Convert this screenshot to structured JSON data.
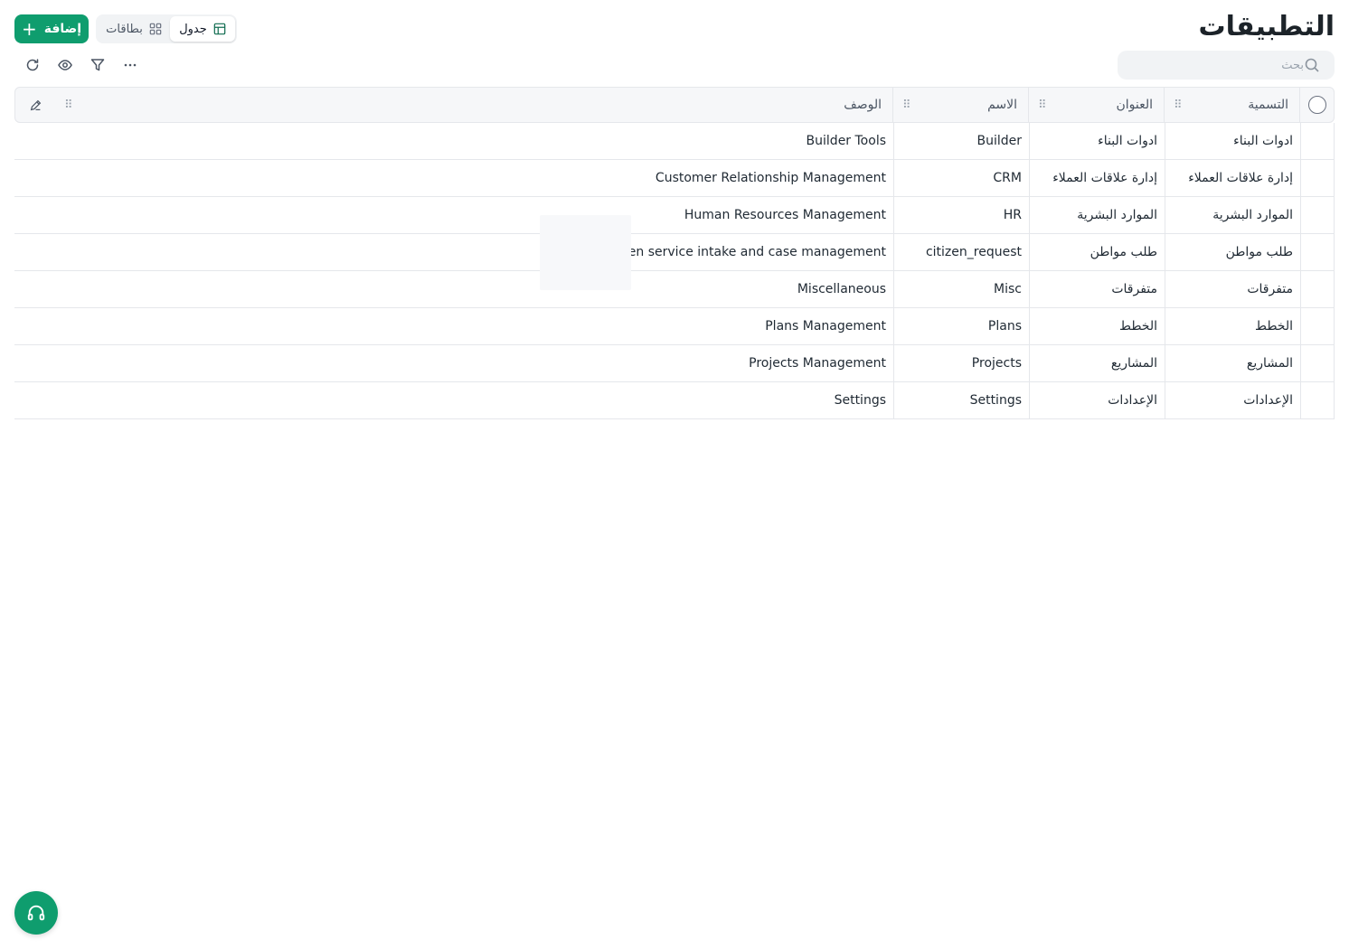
{
  "header": {
    "title": "التطبيقات",
    "add_label": "إضافة",
    "view_table_label": "جدول",
    "view_cards_label": "بطاقات"
  },
  "search": {
    "placeholder": "بحث",
    "value": ""
  },
  "toolbar": {
    "icons": [
      "refresh-icon",
      "eye-icon",
      "filter-icon",
      "more-icon"
    ]
  },
  "table": {
    "columns": {
      "label": "التسمية",
      "title": "العنوان",
      "name": "الاسم",
      "description": "الوصف"
    },
    "rows": [
      {
        "label": "ادوات البناء",
        "title": "ادوات البناء",
        "name": "Builder",
        "description": "Builder Tools"
      },
      {
        "label": "إدارة علاقات العملاء",
        "title": "إدارة علاقات العملاء",
        "name": "CRM",
        "description": "Customer Relationship Management"
      },
      {
        "label": "الموارد البشرية",
        "title": "الموارد البشرية",
        "name": "HR",
        "description": "Human Resources Management"
      },
      {
        "label": "طلب مواطن",
        "title": "طلب مواطن",
        "name": "citizen_request",
        "description": "Citizen service intake and case management"
      },
      {
        "label": "متفرقات",
        "title": "متفرقات",
        "name": "Misc",
        "description": "Miscellaneous"
      },
      {
        "label": "الخطط",
        "title": "الخطط",
        "name": "Plans",
        "description": "Plans Management"
      },
      {
        "label": "المشاريع",
        "title": "المشاريع",
        "name": "Projects",
        "description": "Projects Management"
      },
      {
        "label": "الإعدادات",
        "title": "الإعدادات",
        "name": "Settings",
        "description": "Settings"
      }
    ]
  },
  "colors": {
    "accent": "#0f9d6e",
    "header_bg": "#f6f7f9",
    "border": "#e5e7eb"
  }
}
